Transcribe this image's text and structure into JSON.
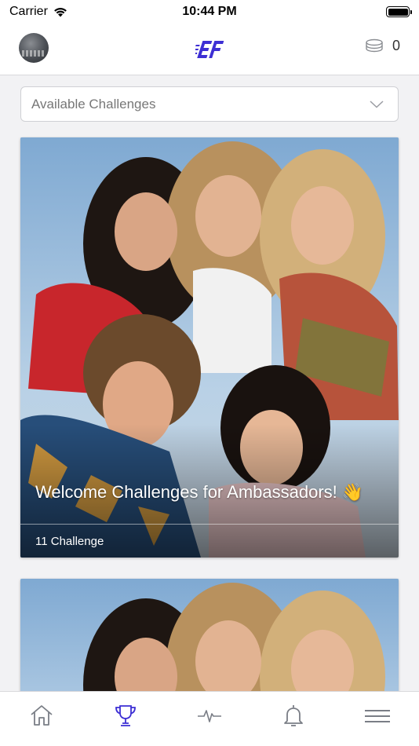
{
  "status_bar": {
    "carrier": "Carrier",
    "time": "10:44 PM"
  },
  "header": {
    "logo_text": "EF",
    "coin_count": "0"
  },
  "filter": {
    "selected": "Available Challenges"
  },
  "cards": [
    {
      "title": "Welcome Challenges for Ambassadors! 👋",
      "meta": "11 Challenge"
    },
    {
      "title": "",
      "meta": ""
    }
  ],
  "tabs": [
    {
      "name": "home",
      "icon": "home-icon",
      "active": false
    },
    {
      "name": "challenges",
      "icon": "trophy-icon",
      "active": true
    },
    {
      "name": "activity",
      "icon": "pulse-icon",
      "active": false
    },
    {
      "name": "notifications",
      "icon": "bell-icon",
      "active": false
    },
    {
      "name": "menu",
      "icon": "hamburger-icon",
      "active": false
    }
  ],
  "colors": {
    "accent": "#3d2fd4",
    "tab_inactive": "#7a7e86",
    "background": "#f2f2f4"
  }
}
